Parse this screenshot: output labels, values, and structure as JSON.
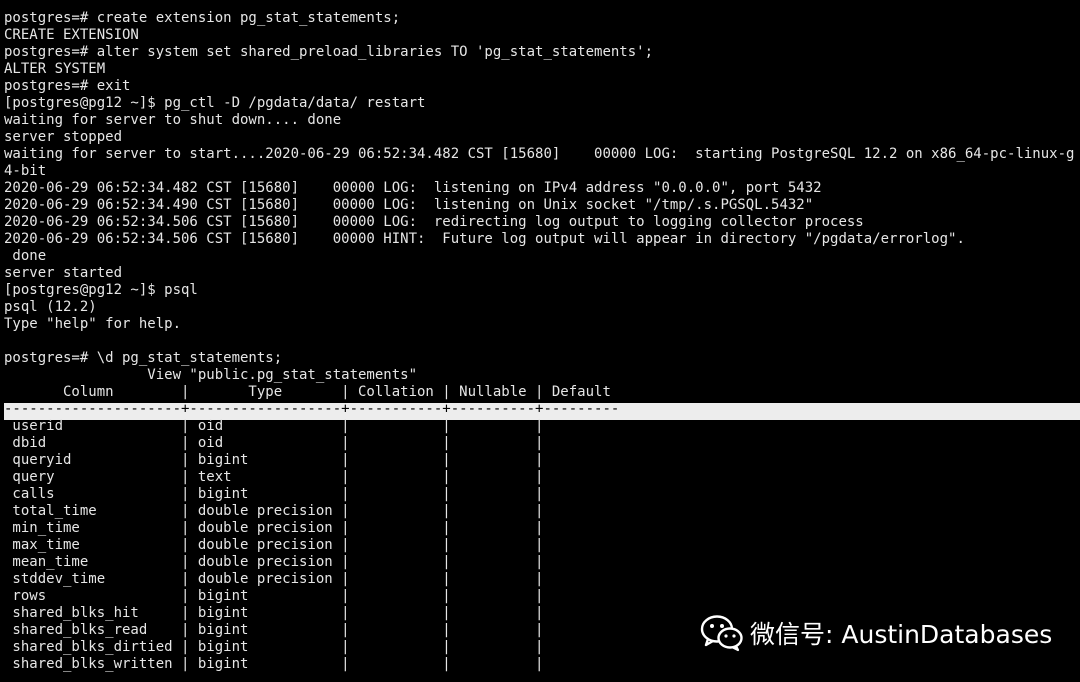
{
  "terminal": {
    "background": "#000000",
    "foreground": "#e6e6e6",
    "lines": [
      "postgres=# create extension pg_stat_statements;",
      "CREATE EXTENSION",
      "postgres=# alter system set shared_preload_libraries TO 'pg_stat_statements';",
      "ALTER SYSTEM",
      "postgres=# exit",
      "[postgres@pg12 ~]$ pg_ctl -D /pgdata/data/ restart",
      "waiting for server to shut down.... done",
      "server stopped",
      "waiting for server to start....2020-06-29 06:52:34.482 CST [15680]    00000 LOG:  starting PostgreSQL 12.2 on x86_64-pc-linux-g",
      "4-bit",
      "2020-06-29 06:52:34.482 CST [15680]    00000 LOG:  listening on IPv4 address \"0.0.0.0\", port 5432",
      "2020-06-29 06:52:34.490 CST [15680]    00000 LOG:  listening on Unix socket \"/tmp/.s.PGSQL.5432\"",
      "2020-06-29 06:52:34.506 CST [15680]    00000 LOG:  redirecting log output to logging collector process",
      "2020-06-29 06:52:34.506 CST [15680]    00000 HINT:  Future log output will appear in directory \"/pgdata/errorlog\".",
      " done",
      "server started",
      "[postgres@pg12 ~]$ psql",
      "psql (12.2)",
      "Type \"help\" for help.",
      "",
      "postgres=# \\d pg_stat_statements;",
      "                 View \"public.pg_stat_statements\"",
      "       Column        |       Type       | Collation | Nullable | Default",
      "---------------------+------------------+-----------+----------+---------",
      " userid              | oid              |           |          |",
      " dbid                | oid              |           |          |",
      " queryid             | bigint           |           |          |",
      " query               | text             |           |          |",
      " calls               | bigint           |           |          |",
      " total_time          | double precision |           |          |",
      " min_time            | double precision |           |          |",
      " max_time            | double precision |           |          |",
      " mean_time           | double precision |           |          |",
      " stddev_time         | double precision |           |          |",
      " rows                | bigint           |           |          |",
      " shared_blks_hit     | bigint           |           |          |",
      " shared_blks_read    | bigint           |           |          |",
      " shared_blks_dirtied | bigint           |           |          |",
      " shared_blks_written | bigint           |           |          |"
    ],
    "highlighted_line": 23,
    "highlight_color": "#ededed"
  },
  "watermark": {
    "icon": "wechat-icon",
    "text": "微信号: AustinDatabases",
    "color": "#ffffff"
  }
}
